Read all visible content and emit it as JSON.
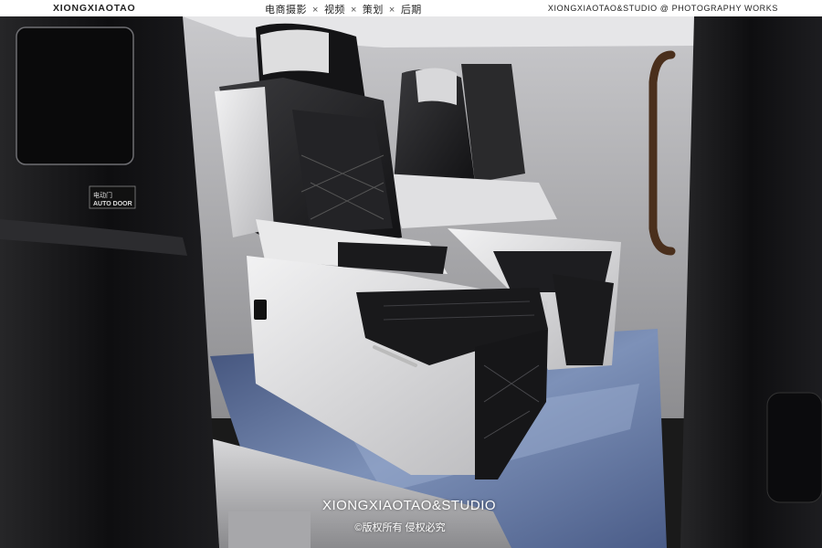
{
  "header": {
    "brand_left": "XIONGXIAOTAO",
    "nav": [
      "电商摄影",
      "视频",
      "策划",
      "后期"
    ],
    "nav_separator": "×",
    "brand_right": "XIONGXIAOTAO&STUDIO @ PHOTOGRAPHY WORKS"
  },
  "photo": {
    "subject": "van-interior-captain-seats",
    "door_label": "AUTO DOOR",
    "door_label_cn": "电动门"
  },
  "watermark": {
    "studio": "XIONGXIAOTAO&STUDIO",
    "copyright": "©版权所有 侵权必究"
  },
  "colors": {
    "leather_black": "#1c1c1e",
    "leather_white": "#e4e4e6",
    "floor_blue": "#5a6f9a",
    "body_black": "#0d0d0f"
  }
}
